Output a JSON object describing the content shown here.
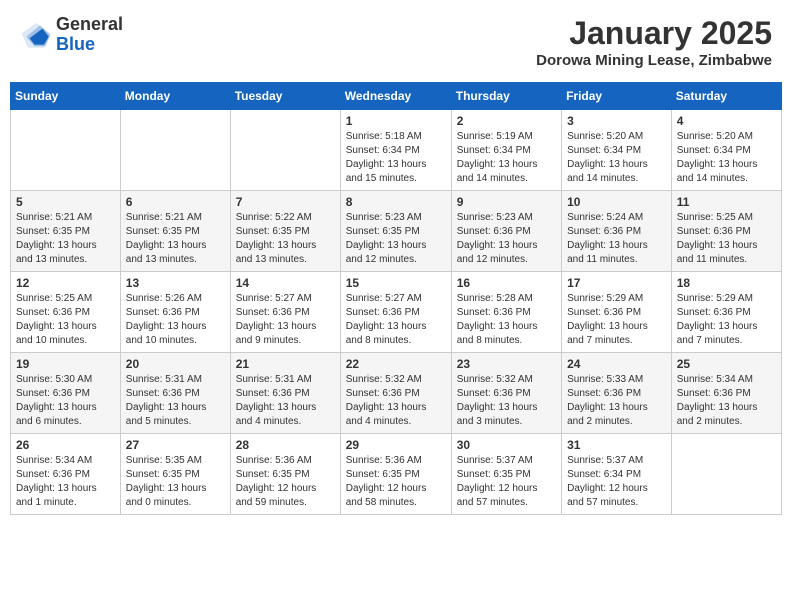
{
  "header": {
    "logo_general": "General",
    "logo_blue": "Blue",
    "month_title": "January 2025",
    "location": "Dorowa Mining Lease, Zimbabwe"
  },
  "days_of_week": [
    "Sunday",
    "Monday",
    "Tuesday",
    "Wednesday",
    "Thursday",
    "Friday",
    "Saturday"
  ],
  "weeks": [
    [
      {
        "day": "",
        "info": ""
      },
      {
        "day": "",
        "info": ""
      },
      {
        "day": "",
        "info": ""
      },
      {
        "day": "1",
        "info": "Sunrise: 5:18 AM\nSunset: 6:34 PM\nDaylight: 13 hours\nand 15 minutes."
      },
      {
        "day": "2",
        "info": "Sunrise: 5:19 AM\nSunset: 6:34 PM\nDaylight: 13 hours\nand 14 minutes."
      },
      {
        "day": "3",
        "info": "Sunrise: 5:20 AM\nSunset: 6:34 PM\nDaylight: 13 hours\nand 14 minutes."
      },
      {
        "day": "4",
        "info": "Sunrise: 5:20 AM\nSunset: 6:34 PM\nDaylight: 13 hours\nand 14 minutes."
      }
    ],
    [
      {
        "day": "5",
        "info": "Sunrise: 5:21 AM\nSunset: 6:35 PM\nDaylight: 13 hours\nand 13 minutes."
      },
      {
        "day": "6",
        "info": "Sunrise: 5:21 AM\nSunset: 6:35 PM\nDaylight: 13 hours\nand 13 minutes."
      },
      {
        "day": "7",
        "info": "Sunrise: 5:22 AM\nSunset: 6:35 PM\nDaylight: 13 hours\nand 13 minutes."
      },
      {
        "day": "8",
        "info": "Sunrise: 5:23 AM\nSunset: 6:35 PM\nDaylight: 13 hours\nand 12 minutes."
      },
      {
        "day": "9",
        "info": "Sunrise: 5:23 AM\nSunset: 6:36 PM\nDaylight: 13 hours\nand 12 minutes."
      },
      {
        "day": "10",
        "info": "Sunrise: 5:24 AM\nSunset: 6:36 PM\nDaylight: 13 hours\nand 11 minutes."
      },
      {
        "day": "11",
        "info": "Sunrise: 5:25 AM\nSunset: 6:36 PM\nDaylight: 13 hours\nand 11 minutes."
      }
    ],
    [
      {
        "day": "12",
        "info": "Sunrise: 5:25 AM\nSunset: 6:36 PM\nDaylight: 13 hours\nand 10 minutes."
      },
      {
        "day": "13",
        "info": "Sunrise: 5:26 AM\nSunset: 6:36 PM\nDaylight: 13 hours\nand 10 minutes."
      },
      {
        "day": "14",
        "info": "Sunrise: 5:27 AM\nSunset: 6:36 PM\nDaylight: 13 hours\nand 9 minutes."
      },
      {
        "day": "15",
        "info": "Sunrise: 5:27 AM\nSunset: 6:36 PM\nDaylight: 13 hours\nand 8 minutes."
      },
      {
        "day": "16",
        "info": "Sunrise: 5:28 AM\nSunset: 6:36 PM\nDaylight: 13 hours\nand 8 minutes."
      },
      {
        "day": "17",
        "info": "Sunrise: 5:29 AM\nSunset: 6:36 PM\nDaylight: 13 hours\nand 7 minutes."
      },
      {
        "day": "18",
        "info": "Sunrise: 5:29 AM\nSunset: 6:36 PM\nDaylight: 13 hours\nand 7 minutes."
      }
    ],
    [
      {
        "day": "19",
        "info": "Sunrise: 5:30 AM\nSunset: 6:36 PM\nDaylight: 13 hours\nand 6 minutes."
      },
      {
        "day": "20",
        "info": "Sunrise: 5:31 AM\nSunset: 6:36 PM\nDaylight: 13 hours\nand 5 minutes."
      },
      {
        "day": "21",
        "info": "Sunrise: 5:31 AM\nSunset: 6:36 PM\nDaylight: 13 hours\nand 4 minutes."
      },
      {
        "day": "22",
        "info": "Sunrise: 5:32 AM\nSunset: 6:36 PM\nDaylight: 13 hours\nand 4 minutes."
      },
      {
        "day": "23",
        "info": "Sunrise: 5:32 AM\nSunset: 6:36 PM\nDaylight: 13 hours\nand 3 minutes."
      },
      {
        "day": "24",
        "info": "Sunrise: 5:33 AM\nSunset: 6:36 PM\nDaylight: 13 hours\nand 2 minutes."
      },
      {
        "day": "25",
        "info": "Sunrise: 5:34 AM\nSunset: 6:36 PM\nDaylight: 13 hours\nand 2 minutes."
      }
    ],
    [
      {
        "day": "26",
        "info": "Sunrise: 5:34 AM\nSunset: 6:36 PM\nDaylight: 13 hours\nand 1 minute."
      },
      {
        "day": "27",
        "info": "Sunrise: 5:35 AM\nSunset: 6:35 PM\nDaylight: 13 hours\nand 0 minutes."
      },
      {
        "day": "28",
        "info": "Sunrise: 5:36 AM\nSunset: 6:35 PM\nDaylight: 12 hours\nand 59 minutes."
      },
      {
        "day": "29",
        "info": "Sunrise: 5:36 AM\nSunset: 6:35 PM\nDaylight: 12 hours\nand 58 minutes."
      },
      {
        "day": "30",
        "info": "Sunrise: 5:37 AM\nSunset: 6:35 PM\nDaylight: 12 hours\nand 57 minutes."
      },
      {
        "day": "31",
        "info": "Sunrise: 5:37 AM\nSunset: 6:34 PM\nDaylight: 12 hours\nand 57 minutes."
      },
      {
        "day": "",
        "info": ""
      }
    ]
  ]
}
